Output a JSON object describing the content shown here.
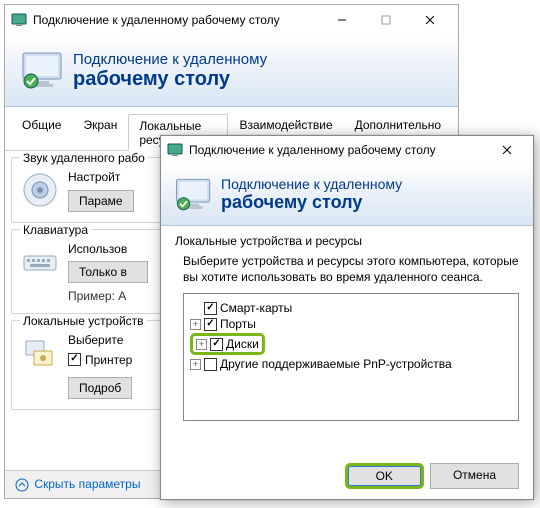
{
  "main": {
    "title": "Подключение к удаленному рабочему столу",
    "banner": {
      "line1": "Подключение к удаленному",
      "line2": "рабочему столу"
    },
    "tabs": [
      "Общие",
      "Экран",
      "Локальные ресурсы",
      "Взаимодействие",
      "Дополнительно"
    ],
    "active_tab": 2,
    "groups": {
      "audio": {
        "title": "Звук удаленного рабо",
        "desc": "Настройт",
        "button": "Параме"
      },
      "keyboard": {
        "title": "Клавиатура",
        "desc": "Использов",
        "button": "Только в",
        "hint": "Пример: A"
      },
      "local": {
        "title": "Локальные устройств",
        "desc": "Выберите",
        "checkbox_label": "Принтер",
        "button": "Подроб"
      }
    },
    "footer_link": "Скрыть параметры"
  },
  "dialog": {
    "title": "Подключение к удаленному рабочему столу",
    "banner": {
      "line1": "Подключение к удаленному",
      "line2": "рабочему столу"
    },
    "section_title": "Локальные устройства и ресурсы",
    "description": "Выберите устройства и ресурсы этого компьютера, которые вы хотите использовать во время удаленного сеанса.",
    "tree": [
      {
        "label": "Смарт-карты",
        "checked": true,
        "expander": null
      },
      {
        "label": "Порты",
        "checked": true,
        "expander": "plus"
      },
      {
        "label": "Диски",
        "checked": true,
        "expander": "plus",
        "highlight": true
      },
      {
        "label": "Другие поддерживаемые PnP-устройства",
        "checked": false,
        "expander": "plus"
      }
    ],
    "ok": "OK",
    "cancel": "Отмена"
  }
}
